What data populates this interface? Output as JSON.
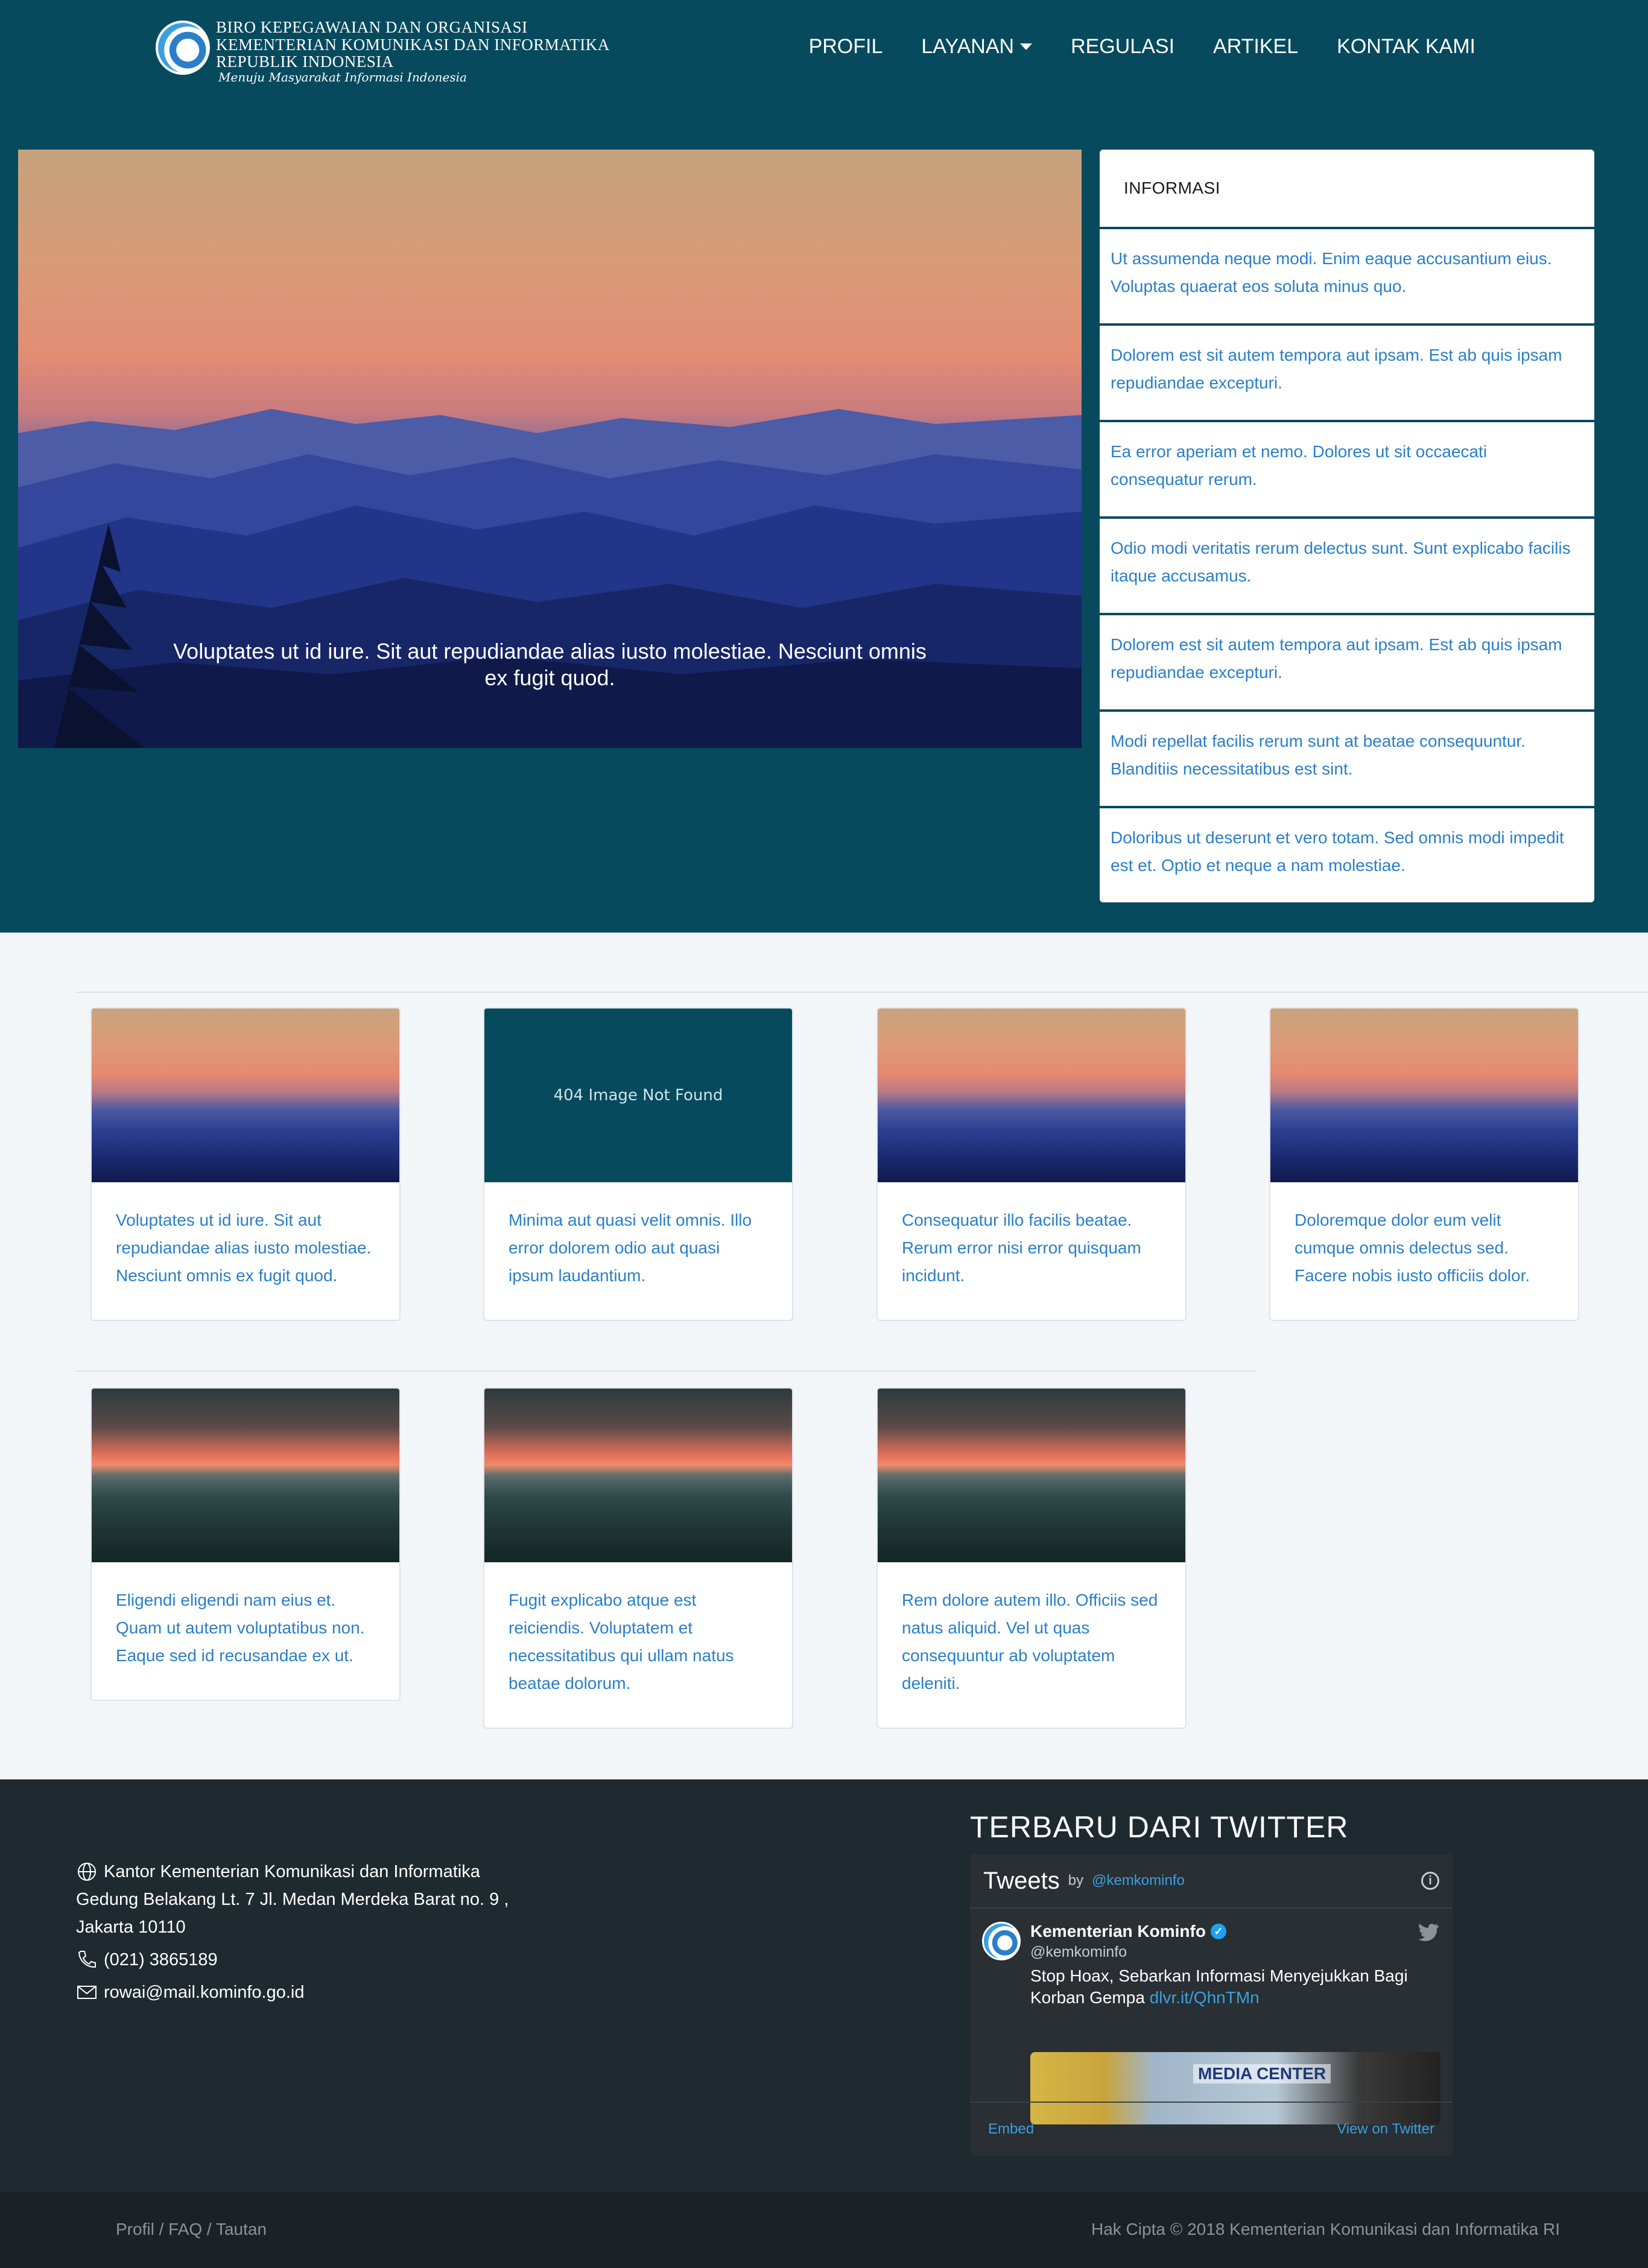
{
  "brand": {
    "line1": "BIRO KEPEGAWAIAN DAN ORGANISASI",
    "line2": "KEMENTERIAN KOMUNIKASI DAN INFORMATIKA",
    "line3": "REPUBLIK INDONESIA",
    "tagline": "Menuju Masyarakat Informasi Indonesia"
  },
  "nav": {
    "items": [
      "PROFIL",
      "LAYANAN",
      "REGULASI",
      "ARTIKEL",
      "KONTAK KAMI"
    ]
  },
  "hero": {
    "caption": "Voluptates ut id iure. Sit aut repudiandae alias iusto molestiae. Nesciunt omnis ex fugit quod."
  },
  "info": {
    "title": "INFORMASI",
    "items": [
      "Ut assumenda neque modi. Enim eaque accusantium eius. Voluptas quaerat eos soluta minus quo.",
      "Dolorem est sit autem tempora aut ipsam. Est ab quis ipsam repudiandae excepturi.",
      "Ea error aperiam et nemo. Dolores ut sit occaecati consequatur rerum.",
      "Odio modi veritatis rerum delectus sunt. Sunt explicabo facilis itaque accusamus.",
      "Dolorem est sit autem tempora aut ipsam. Est ab quis ipsam repudiandae excepturi.",
      "Modi repellat facilis rerum sunt at beatae consequuntur. Blanditiis necessitatibus est sint.",
      "Doloribus ut deserunt et vero totam. Sed omnis modi impedit est et. Optio et neque a nam molestiae."
    ]
  },
  "cards": [
    {
      "text": "Voluptates ut id iure. Sit aut repudiandae alias iusto molestiae. Nesciunt omnis ex fugit quod."
    },
    {
      "text": "Minima aut quasi velit omnis. Illo error dolorem odio aut quasi ipsum laudantium.",
      "image_label": "404 Image Not Found"
    },
    {
      "text": "Consequatur illo facilis beatae. Rerum error nisi error quisquam incidunt."
    },
    {
      "text": "Doloremque dolor eum velit cumque omnis delectus sed. Facere nobis iusto officiis dolor."
    },
    {
      "text": "Eligendi eligendi nam eius et. Quam ut autem voluptatibus non. Eaque sed id recusandae ex ut."
    },
    {
      "text": "Fugit explicabo atque est reiciendis. Voluptatem et necessitatibus qui ullam natus beatae dolorum."
    },
    {
      "text": "Rem dolore autem illo. Officiis sed natus aliquid. Vel ut quas consequuntur ab voluptatem deleniti."
    }
  ],
  "footer": {
    "address_line1": "Kantor Kementerian Komunikasi dan Informatika",
    "address_line2": "Gedung Belakang Lt. 7 Jl. Medan Merdeka Barat no. 9 ,",
    "address_line3": "Jakarta 10110",
    "phone": "(021) 3865189",
    "email": "rowai@mail.kominfo.go.id",
    "twitter_title": "TERBARU DARI TWITTER",
    "bottom_links": "Profil / FAQ / Tautan",
    "copyright": "Hak Cipta © 2018 Kementerian Komunikasi dan Informatika RI"
  },
  "twitter": {
    "header_title": "Tweets",
    "header_by": "by",
    "header_handle": "@kemkominfo",
    "name": "Kementerian Kominfo",
    "handle": "@kemkominfo",
    "text": "Stop Hoax, Sebarkan Informasi Menyejukkan Bagi Korban Gempa",
    "link": "dlvr.it/QhnTMn",
    "media_label": "MEDIA CENTER",
    "embed": "Embed",
    "view": "View on Twitter"
  },
  "colors": {
    "header_bg": "#074a5e",
    "link": "#2a7fc9",
    "footer_bg": "#1f2a30",
    "bottom_bg": "#1b2227"
  }
}
